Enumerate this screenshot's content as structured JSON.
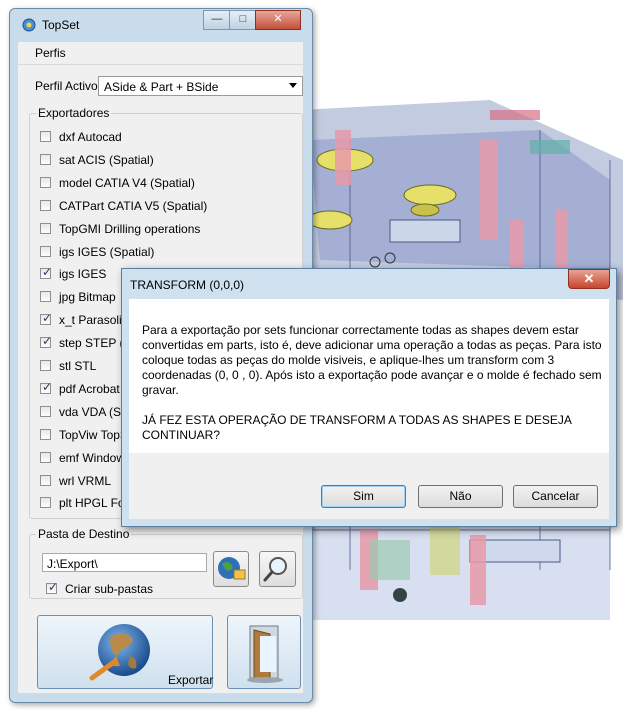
{
  "window": {
    "title": "TopSet",
    "minimize": "—",
    "maximize": "□",
    "close": "✕"
  },
  "menu": {
    "perfis": "Perfis"
  },
  "profile": {
    "label": "Perfil Activo:",
    "value": "ASide & Part + BSide"
  },
  "exporters": {
    "title": "Exportadores",
    "items": [
      {
        "label": "dxf Autocad",
        "checked": false
      },
      {
        "label": "sat ACIS (Spatial)",
        "checked": false
      },
      {
        "label": "model CATIA V4 (Spatial)",
        "checked": false
      },
      {
        "label": "CATPart CATIA V5 (Spatial)",
        "checked": false
      },
      {
        "label": "TopGMI Drilling operations",
        "checked": false
      },
      {
        "label": "igs IGES (Spatial)",
        "checked": false
      },
      {
        "label": "igs IGES",
        "checked": true
      },
      {
        "label": "jpg Bitmap",
        "checked": false
      },
      {
        "label": "x_t Parasolid",
        "checked": true
      },
      {
        "label": "step STEP (S",
        "checked": true
      },
      {
        "label": "stl STL",
        "checked": false
      },
      {
        "label": "pdf Acrobat F",
        "checked": true
      },
      {
        "label": "vda VDA (Spa",
        "checked": false
      },
      {
        "label": "TopViw TopS",
        "checked": false
      },
      {
        "label": "emf Windows",
        "checked": false
      },
      {
        "label": "wrl VRML",
        "checked": false
      },
      {
        "label": "plt HPGL For",
        "checked": false
      }
    ]
  },
  "destination": {
    "title": "Pasta de Destino",
    "path": "J:\\Export\\",
    "subfolders_label": "Criar sub-pastas",
    "subfolders_checked": true
  },
  "export_button": {
    "label": "Exportar"
  },
  "dialog": {
    "title": "TRANSFORM (0,0,0)",
    "close": "✕",
    "message1": "Para a exportação por sets funcionar correctamente todas as shapes devem estar convertidas em parts, isto é, deve adicionar uma operação a todas as peças. Para isto coloque todas as peças do molde visiveis, e aplique-lhes um transform com 3 coordenadas (0, 0 , 0). Após isto a exportação pode avançar e o molde é fechado sem gravar.",
    "message2": "JÁ FEZ ESTA OPERAÇÃO DE TRANSFORM A TODAS AS SHAPES E DESEJA CONTINUAR?",
    "buttons": {
      "yes": "Sim",
      "no": "Não",
      "cancel": "Cancelar"
    }
  },
  "colors": {
    "window_frame": "#c9dcec",
    "client": "#f0f0f0",
    "dialog_frame": "#cfe0ef",
    "close_red": "#c7452e"
  }
}
